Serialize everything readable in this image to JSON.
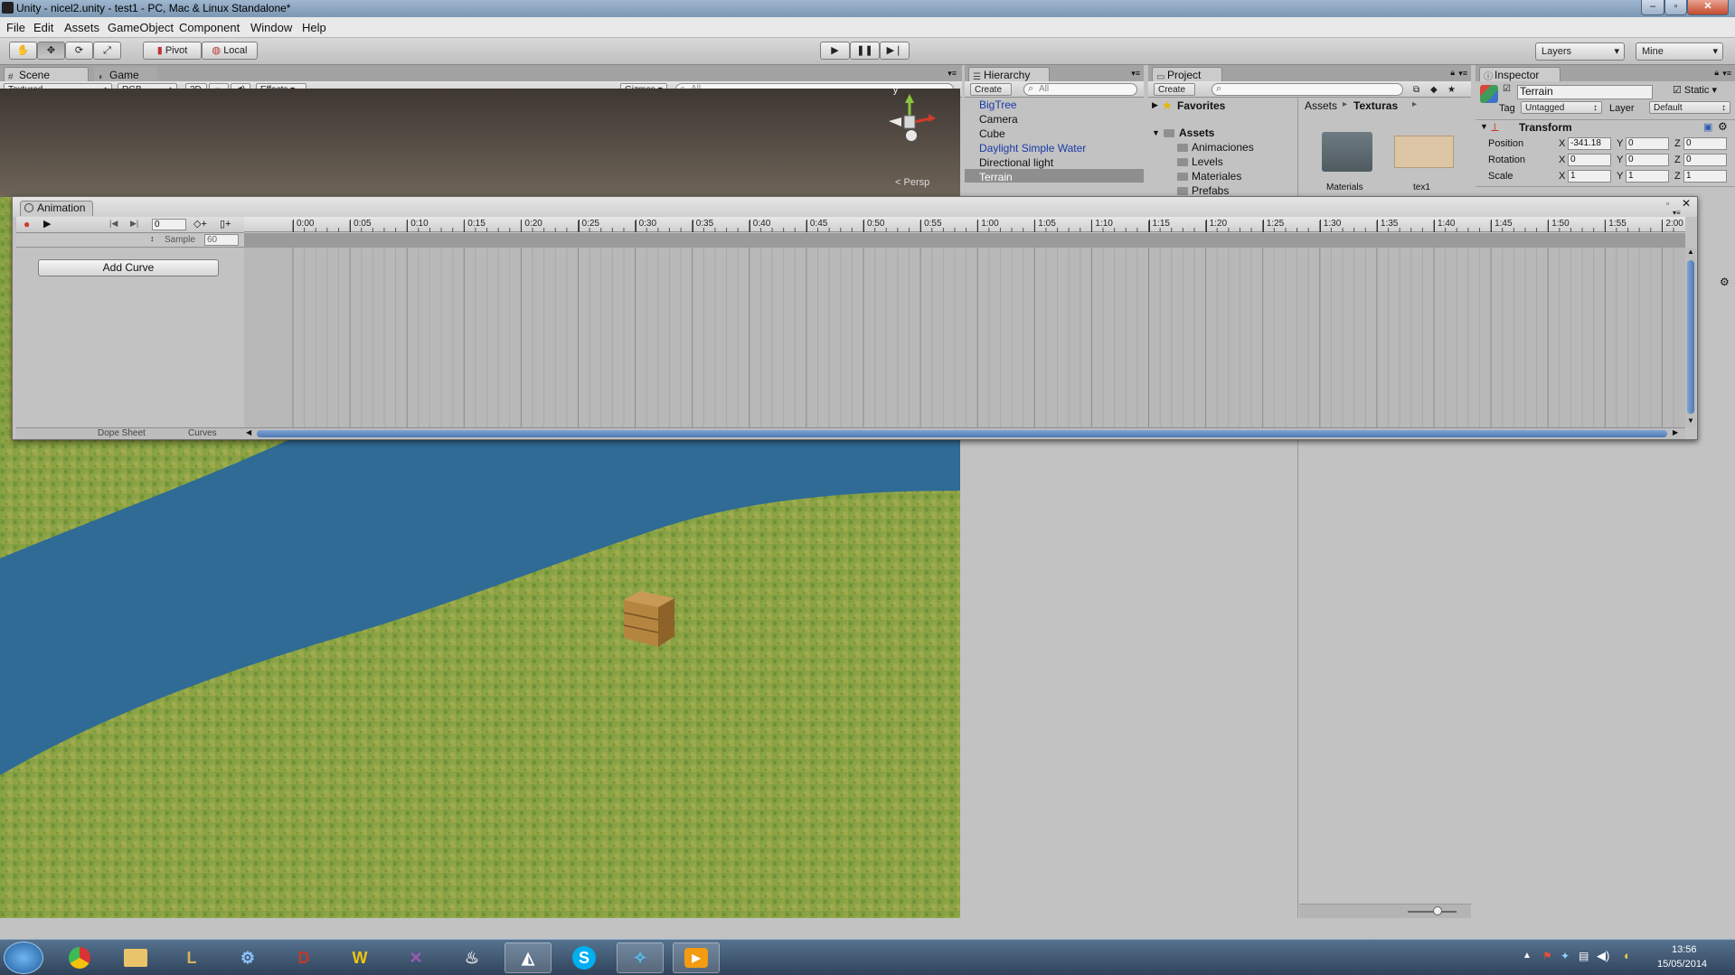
{
  "window": {
    "title": "Unity - nicel2.unity - test1 - PC, Mac & Linux Standalone*",
    "controls": [
      "–",
      "▫",
      "✕"
    ]
  },
  "menu": [
    "File",
    "Edit",
    "Assets",
    "GameObject",
    "Component",
    "Window",
    "Help"
  ],
  "toolbar": {
    "pivot": "Pivot",
    "local": "Local",
    "layers": "Layers",
    "layout": "Mine"
  },
  "scene": {
    "tab_scene": "Scene",
    "tab_game": "Game",
    "shading": "Textured",
    "render_mode": "RGB",
    "mode_2d": "2D",
    "effects": "Effects",
    "gizmos": "Gizmos",
    "search": "All",
    "gizmo_y": "y",
    "persp": "Persp"
  },
  "animation": {
    "title": "Animation",
    "frame": "0",
    "sample_label": "Sample",
    "sample_value": "60",
    "add_curve": "Add Curve",
    "dope_sheet": "Dope Sheet",
    "curves": "Curves",
    "ticks": [
      "0:00",
      "0:05",
      "0:10",
      "0:15",
      "0:20",
      "0:25",
      "0:30",
      "0:35",
      "0:40",
      "0:45",
      "0:50",
      "0:55",
      "1:00",
      "1:05",
      "1:10",
      "1:15",
      "1:20",
      "1:25",
      "1:30",
      "1:35",
      "1:40",
      "1:45",
      "1:50",
      "1:55",
      "2:00"
    ]
  },
  "hierarchy": {
    "title": "Hierarchy",
    "create": "Create",
    "search": "All",
    "items": [
      "BigTree",
      "Camera",
      "Cube",
      "Daylight Simple Water",
      "Directional light",
      "Terrain"
    ],
    "selected": "Terrain"
  },
  "project": {
    "title": "Project",
    "create": "Create",
    "favorites": "Favorites",
    "assets": "Assets",
    "folders": [
      "Animaciones",
      "Levels",
      "Materiales",
      "Prefabs"
    ],
    "breadcrumb": [
      "Assets",
      "Texturas"
    ],
    "grid_items": [
      "Materials",
      "tex1"
    ]
  },
  "inspector": {
    "title": "Inspector",
    "object_name": "Terrain",
    "static": "Static",
    "tag_label": "Tag",
    "tag_value": "Untagged",
    "layer_label": "Layer",
    "layer_value": "Default",
    "component": "Transform",
    "rows": [
      {
        "label": "Position",
        "x": "-341.18",
        "y": "0",
        "z": "0"
      },
      {
        "label": "Rotation",
        "x": "0",
        "y": "0",
        "z": "0"
      },
      {
        "label": "Scale",
        "x": "1",
        "y": "1",
        "z": "1"
      }
    ],
    "axis": [
      "X",
      "Y",
      "Z"
    ]
  },
  "taskbar": {
    "apps": [
      "chrome",
      "explorer",
      "league-of-legends",
      "launcher",
      "diablo",
      "warcraft",
      "starcraft",
      "steam",
      "unity",
      "skype",
      "battlenet",
      "media-player"
    ],
    "time": "13:56",
    "date": "15/05/2014"
  },
  "colors": {
    "selection": "#3e7ce0",
    "prefab_text": "#1a3aa8",
    "record": "#d23a2a"
  }
}
